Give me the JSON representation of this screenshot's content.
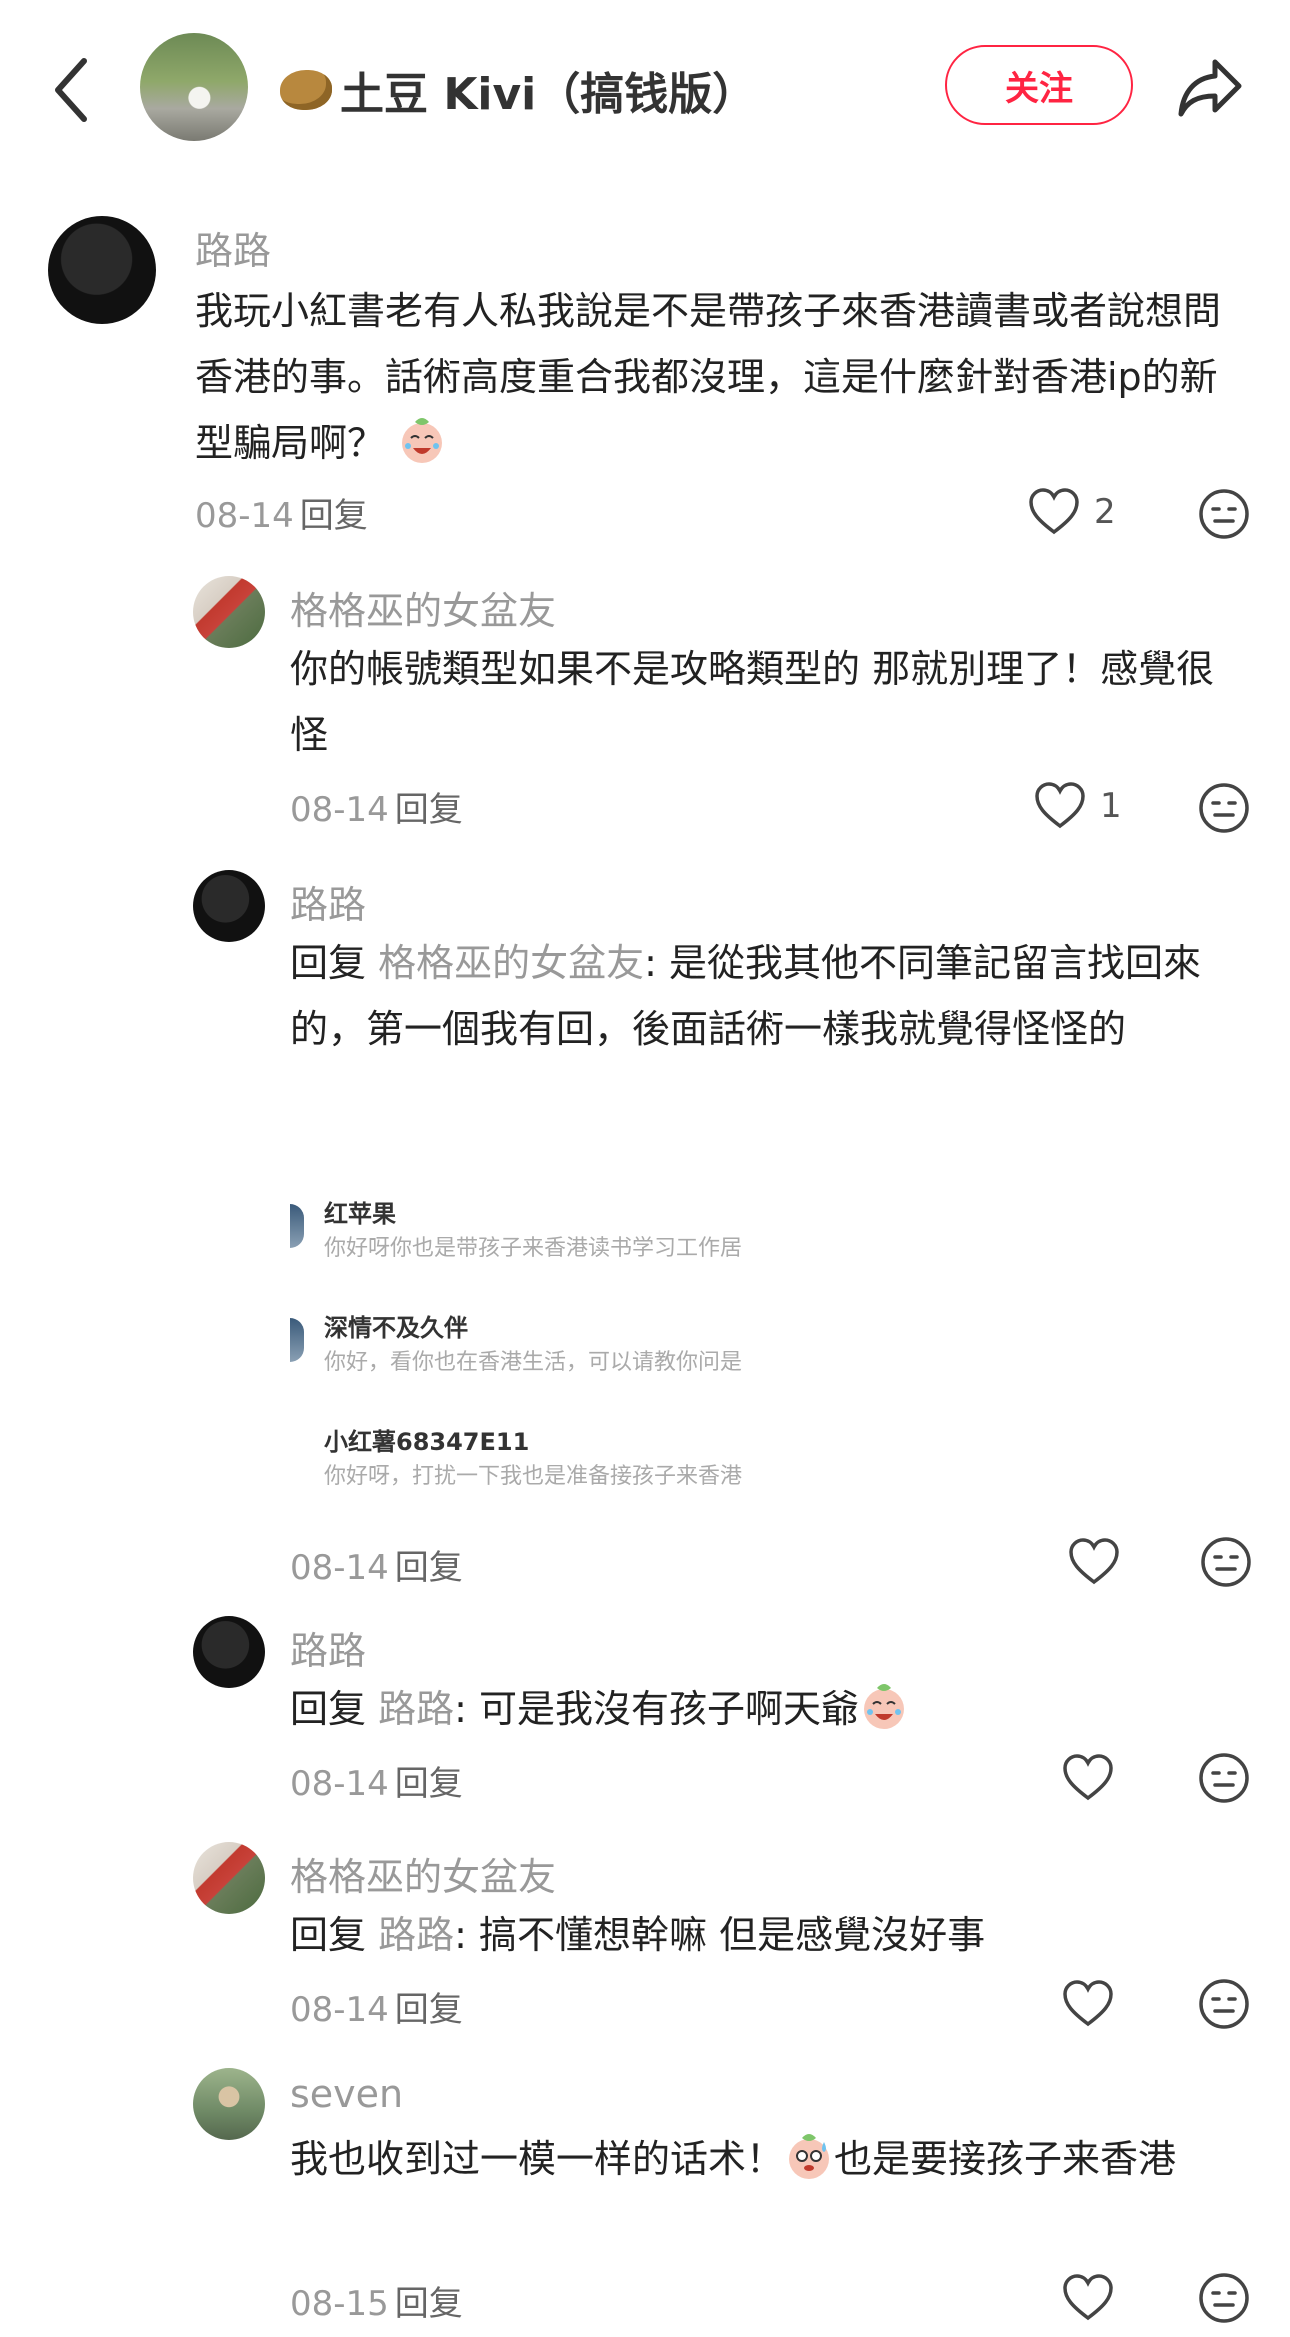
{
  "header": {
    "author_name": "土豆 Kivi（搞钱版）",
    "follow_label": "关注",
    "icons": [
      "back-arrow-icon",
      "share-icon"
    ]
  },
  "comments": [
    {
      "user": "路路",
      "text": "我玩小紅書老有人私我說是不是帶孩子來香港讀書或者說想問香港的事。話術高度重合我都沒理，這是什麼針對香港ip的新型騙局啊？",
      "date": "08-14",
      "reply_label": "回复",
      "likes": "2"
    },
    {
      "user": "格格巫的女盆友",
      "text": "你的帳號類型如果不是攻略類型的 那就別理了！感覺很怪",
      "date": "08-14",
      "reply_label": "回复",
      "likes": "1"
    },
    {
      "user": "路路",
      "reply_prefix": "回复",
      "reply_to": "格格巫的女盆友",
      "text": ": 是從我其他不同筆記留言找回來的，第一個我有回，後面話術一樣我就覺得怪怪的",
      "date": "08-14",
      "reply_label": "回复",
      "embedded": [
        {
          "name": "红苹果",
          "msg": "你好呀你也是带孩子来香港读书学习工作居"
        },
        {
          "name": "深情不及久伴",
          "msg": "你好，看你也在香港生活，可以请教你问是"
        },
        {
          "name": "小红薯68347E11",
          "msg": "你好呀，打扰一下我也是准备接孩子来香港"
        }
      ]
    },
    {
      "user": "路路",
      "reply_prefix": "回复",
      "reply_to": "路路",
      "text": ": 可是我沒有孩子啊天爺",
      "date": "08-14",
      "reply_label": "回复"
    },
    {
      "user": "格格巫的女盆友",
      "reply_prefix": "回复",
      "reply_to": "路路",
      "text": ": 搞不懂想幹嘛 但是感覺沒好事",
      "date": "08-14",
      "reply_label": "回复"
    },
    {
      "user": "seven",
      "text_a": "我也收到过一模一样的话术！",
      "text_b": "也是要接孩子来香港",
      "date": "08-15",
      "reply_label": "回复"
    }
  ]
}
